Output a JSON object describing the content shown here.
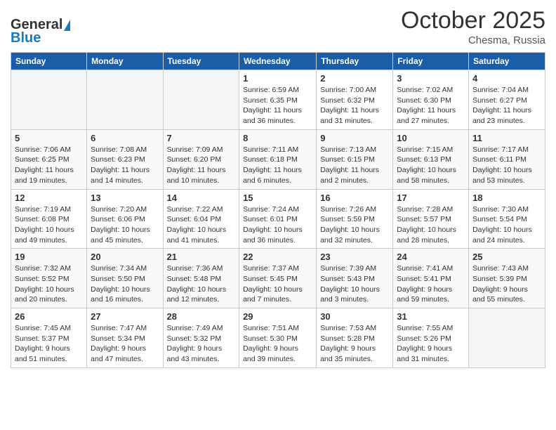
{
  "logo": {
    "general": "General",
    "blue": "Blue"
  },
  "header": {
    "month": "October 2025",
    "location": "Chesma, Russia"
  },
  "days_of_week": [
    "Sunday",
    "Monday",
    "Tuesday",
    "Wednesday",
    "Thursday",
    "Friday",
    "Saturday"
  ],
  "weeks": [
    [
      {
        "day": "",
        "info": ""
      },
      {
        "day": "",
        "info": ""
      },
      {
        "day": "",
        "info": ""
      },
      {
        "day": "1",
        "info": "Sunrise: 6:59 AM\nSunset: 6:35 PM\nDaylight: 11 hours\nand 36 minutes."
      },
      {
        "day": "2",
        "info": "Sunrise: 7:00 AM\nSunset: 6:32 PM\nDaylight: 11 hours\nand 31 minutes."
      },
      {
        "day": "3",
        "info": "Sunrise: 7:02 AM\nSunset: 6:30 PM\nDaylight: 11 hours\nand 27 minutes."
      },
      {
        "day": "4",
        "info": "Sunrise: 7:04 AM\nSunset: 6:27 PM\nDaylight: 11 hours\nand 23 minutes."
      }
    ],
    [
      {
        "day": "5",
        "info": "Sunrise: 7:06 AM\nSunset: 6:25 PM\nDaylight: 11 hours\nand 19 minutes."
      },
      {
        "day": "6",
        "info": "Sunrise: 7:08 AM\nSunset: 6:23 PM\nDaylight: 11 hours\nand 14 minutes."
      },
      {
        "day": "7",
        "info": "Sunrise: 7:09 AM\nSunset: 6:20 PM\nDaylight: 11 hours\nand 10 minutes."
      },
      {
        "day": "8",
        "info": "Sunrise: 7:11 AM\nSunset: 6:18 PM\nDaylight: 11 hours\nand 6 minutes."
      },
      {
        "day": "9",
        "info": "Sunrise: 7:13 AM\nSunset: 6:15 PM\nDaylight: 11 hours\nand 2 minutes."
      },
      {
        "day": "10",
        "info": "Sunrise: 7:15 AM\nSunset: 6:13 PM\nDaylight: 10 hours\nand 58 minutes."
      },
      {
        "day": "11",
        "info": "Sunrise: 7:17 AM\nSunset: 6:11 PM\nDaylight: 10 hours\nand 53 minutes."
      }
    ],
    [
      {
        "day": "12",
        "info": "Sunrise: 7:19 AM\nSunset: 6:08 PM\nDaylight: 10 hours\nand 49 minutes."
      },
      {
        "day": "13",
        "info": "Sunrise: 7:20 AM\nSunset: 6:06 PM\nDaylight: 10 hours\nand 45 minutes."
      },
      {
        "day": "14",
        "info": "Sunrise: 7:22 AM\nSunset: 6:04 PM\nDaylight: 10 hours\nand 41 minutes."
      },
      {
        "day": "15",
        "info": "Sunrise: 7:24 AM\nSunset: 6:01 PM\nDaylight: 10 hours\nand 36 minutes."
      },
      {
        "day": "16",
        "info": "Sunrise: 7:26 AM\nSunset: 5:59 PM\nDaylight: 10 hours\nand 32 minutes."
      },
      {
        "day": "17",
        "info": "Sunrise: 7:28 AM\nSunset: 5:57 PM\nDaylight: 10 hours\nand 28 minutes."
      },
      {
        "day": "18",
        "info": "Sunrise: 7:30 AM\nSunset: 5:54 PM\nDaylight: 10 hours\nand 24 minutes."
      }
    ],
    [
      {
        "day": "19",
        "info": "Sunrise: 7:32 AM\nSunset: 5:52 PM\nDaylight: 10 hours\nand 20 minutes."
      },
      {
        "day": "20",
        "info": "Sunrise: 7:34 AM\nSunset: 5:50 PM\nDaylight: 10 hours\nand 16 minutes."
      },
      {
        "day": "21",
        "info": "Sunrise: 7:36 AM\nSunset: 5:48 PM\nDaylight: 10 hours\nand 12 minutes."
      },
      {
        "day": "22",
        "info": "Sunrise: 7:37 AM\nSunset: 5:45 PM\nDaylight: 10 hours\nand 7 minutes."
      },
      {
        "day": "23",
        "info": "Sunrise: 7:39 AM\nSunset: 5:43 PM\nDaylight: 10 hours\nand 3 minutes."
      },
      {
        "day": "24",
        "info": "Sunrise: 7:41 AM\nSunset: 5:41 PM\nDaylight: 9 hours\nand 59 minutes."
      },
      {
        "day": "25",
        "info": "Sunrise: 7:43 AM\nSunset: 5:39 PM\nDaylight: 9 hours\nand 55 minutes."
      }
    ],
    [
      {
        "day": "26",
        "info": "Sunrise: 7:45 AM\nSunset: 5:37 PM\nDaylight: 9 hours\nand 51 minutes."
      },
      {
        "day": "27",
        "info": "Sunrise: 7:47 AM\nSunset: 5:34 PM\nDaylight: 9 hours\nand 47 minutes."
      },
      {
        "day": "28",
        "info": "Sunrise: 7:49 AM\nSunset: 5:32 PM\nDaylight: 9 hours\nand 43 minutes."
      },
      {
        "day": "29",
        "info": "Sunrise: 7:51 AM\nSunset: 5:30 PM\nDaylight: 9 hours\nand 39 minutes."
      },
      {
        "day": "30",
        "info": "Sunrise: 7:53 AM\nSunset: 5:28 PM\nDaylight: 9 hours\nand 35 minutes."
      },
      {
        "day": "31",
        "info": "Sunrise: 7:55 AM\nSunset: 5:26 PM\nDaylight: 9 hours\nand 31 minutes."
      },
      {
        "day": "",
        "info": ""
      }
    ]
  ]
}
